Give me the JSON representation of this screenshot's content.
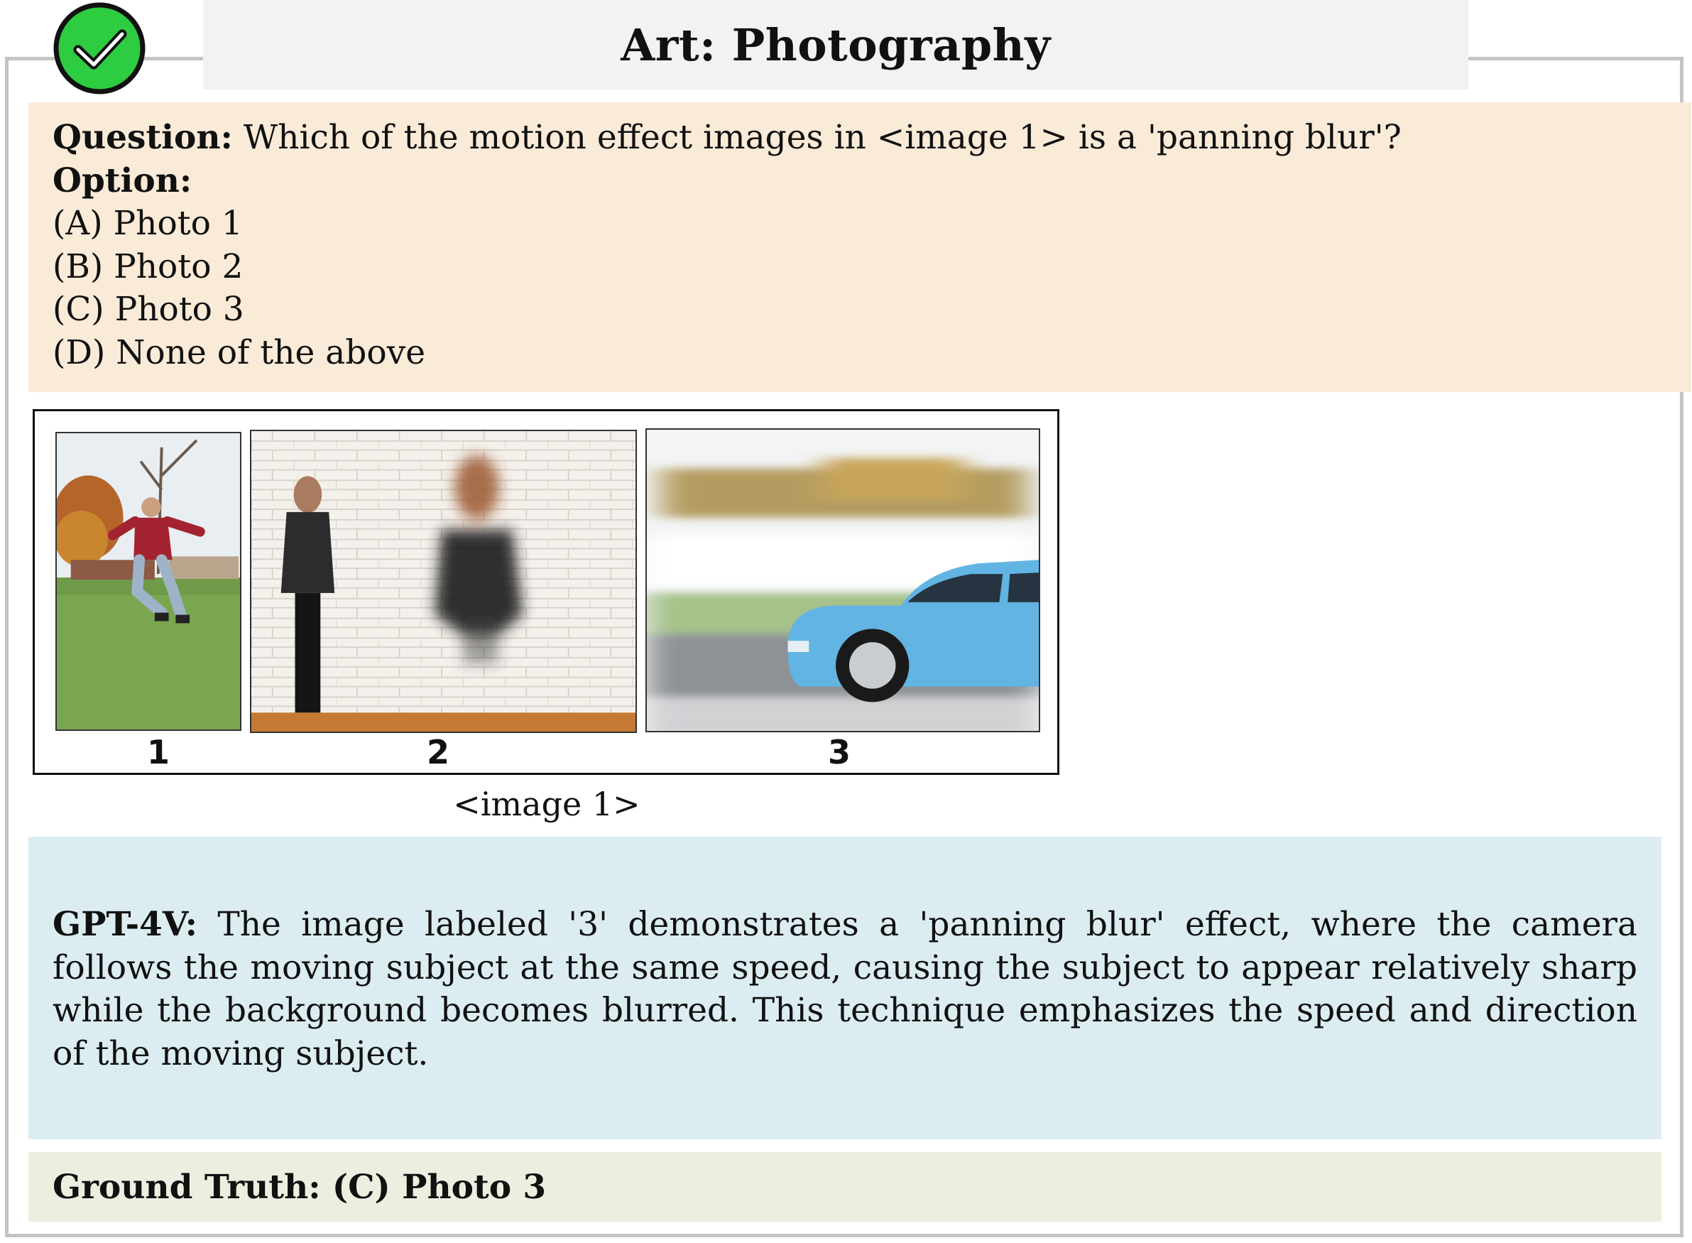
{
  "header": {
    "title": "Art: Photography",
    "status_icon": "check-circle-icon",
    "status_color": "#2ecc40"
  },
  "question": {
    "label": "Question:",
    "text": " Which of the motion effect images in <image 1> is a 'panning blur'?",
    "options_label": "Option:",
    "options": [
      "(A) Photo 1",
      "(B) Photo 2",
      "(C) Photo 3",
      "(D) None of the above"
    ]
  },
  "figure": {
    "photos": [
      {
        "label": "1"
      },
      {
        "label": "2"
      },
      {
        "label": "3"
      }
    ],
    "caption": "<image 1>"
  },
  "answer": {
    "label": "GPT-4V:",
    "text": " The image labeled '3' demonstrates a 'panning blur' effect, where the camera follows the moving subject at the same speed, causing the subject to appear relatively sharp while the background becomes blurred. This technique emphasizes the speed and direction of the moving subject."
  },
  "ground_truth": {
    "text": "Ground Truth: (C) Photo 3"
  }
}
